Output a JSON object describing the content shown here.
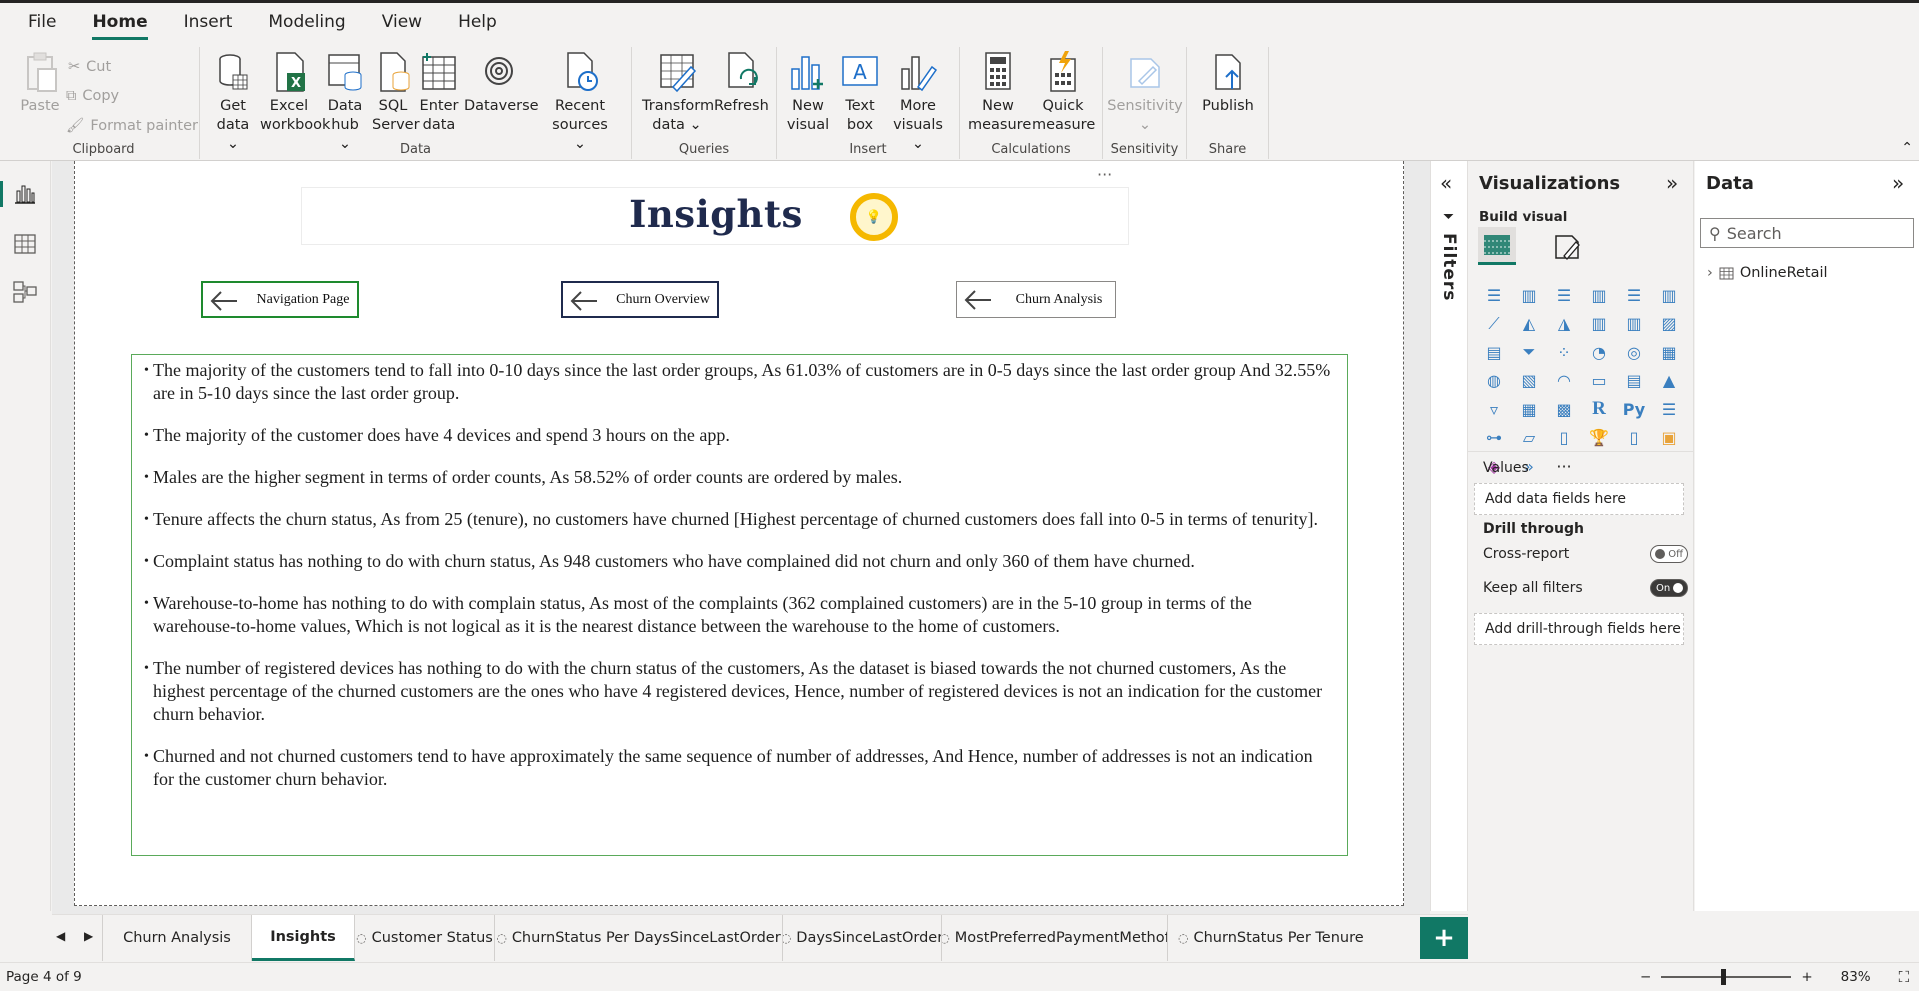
{
  "menu": {
    "items": [
      "File",
      "Home",
      "Insert",
      "Modeling",
      "View",
      "Help"
    ],
    "active": "Home"
  },
  "ribbon": {
    "clipboard": {
      "label": "Clipboard",
      "paste": "Paste",
      "cut": "Cut",
      "copy": "Copy",
      "format_painter": "Format painter"
    },
    "data": {
      "label": "Data",
      "get_data": [
        "Get",
        "data"
      ],
      "excel_workbook": [
        "Excel",
        "workbook"
      ],
      "data_hub": [
        "Data",
        "hub"
      ],
      "sql_server": [
        "SQL",
        "Server"
      ],
      "enter_data": [
        "Enter",
        "data"
      ],
      "dataverse": "Dataverse",
      "recent_sources": [
        "Recent",
        "sources"
      ]
    },
    "queries": {
      "label": "Queries",
      "transform_data": [
        "Transform",
        "data"
      ],
      "refresh": "Refresh"
    },
    "insert": {
      "label": "Insert",
      "new_visual": [
        "New",
        "visual"
      ],
      "text_box": [
        "Text",
        "box"
      ],
      "more_visuals": [
        "More",
        "visuals"
      ]
    },
    "calculations": {
      "label": "Calculations",
      "new_measure": [
        "New",
        "measure"
      ],
      "quick_measure": [
        "Quick",
        "measure"
      ]
    },
    "sensitivity": {
      "label": "Sensitivity",
      "button": "Sensitivity"
    },
    "share": {
      "label": "Share",
      "publish": "Publish"
    }
  },
  "report": {
    "title": "Insights",
    "nav_buttons": [
      "Navigation Page",
      "Churn Overview",
      "Churn Analysis"
    ],
    "insights": [
      "The majority of the customers tend to fall into 0-10 days since the last order groups, As 61.03% of customers are in 0-5 days since the last order group And 32.55% are in 5-10 days since the last order group.",
      "The majority of the customer does have 4 devices and spend 3 hours on the app.",
      "Males are the higher segment in terms of order counts, As 58.52% of order counts are ordered by males.",
      "Tenure affects the churn status, As from 25 (tenure), no customers have churned [Highest percentage of churned customers does fall into 0-5 in terms of tenurity].",
      "Complaint status has nothing to do with churn status, As 948 customers who have complained did not churn and only 360 of them have churned.",
      "Warehouse-to-home has nothing to do with complain status, As most of the complaints (362 complained customers) are in the 5-10 group in terms of the warehouse-to-home values, Which is not logical as it is the nearest distance between the warehouse to the home of customers.",
      "The number of registered devices has nothing to do with the churn status of the customers, As the dataset is biased towards the not churned customers, As the highest percentage of the churned customers are the ones who have 4 registered devices, Hence, number of registered devices is not an indication for the customer churn behavior.",
      "Churned and not churned customers tend to have approximately the same sequence of number of addresses, And Hence, number of addresses is not an indication for the customer churn behavior."
    ]
  },
  "filters": {
    "label": "Filters"
  },
  "visualizations": {
    "title": "Visualizations",
    "build_visual": "Build visual",
    "values_label": "Values",
    "values_placeholder": "Add data fields here",
    "drill_through_label": "Drill through",
    "cross_report": {
      "label": "Cross-report",
      "state": "Off"
    },
    "keep_all_filters": {
      "label": "Keep all filters",
      "state": "On"
    },
    "drill_placeholder": "Add drill-through fields here"
  },
  "data_pane": {
    "title": "Data",
    "search_placeholder": "Search",
    "tables": [
      "OnlineRetail"
    ]
  },
  "tabs": [
    {
      "label": "Churn Analysis",
      "hidden": false
    },
    {
      "label": "Insights",
      "hidden": false,
      "active": true
    },
    {
      "label": "Customer Status",
      "hidden": true
    },
    {
      "label": "ChurnStatus Per DaysSinceLastOrder",
      "hidden": true
    },
    {
      "label": "DaysSinceLastOrder",
      "hidden": true
    },
    {
      "label": "MostPreferredPaymentMethof",
      "hidden": true
    },
    {
      "label": "ChurnStatus Per Tenure",
      "hidden": true
    }
  ],
  "status": {
    "page_indicator": "Page 4 of 9",
    "zoom": "83%"
  },
  "colors": {
    "accent": "#117865",
    "title": "#1f2a4d",
    "nav_green": "#1e8a2e",
    "nav_navy": "#1f2a4d",
    "nav_gray": "#8a8886",
    "textbox_border": "#5aaa5a",
    "bulb": "#f5b800"
  }
}
